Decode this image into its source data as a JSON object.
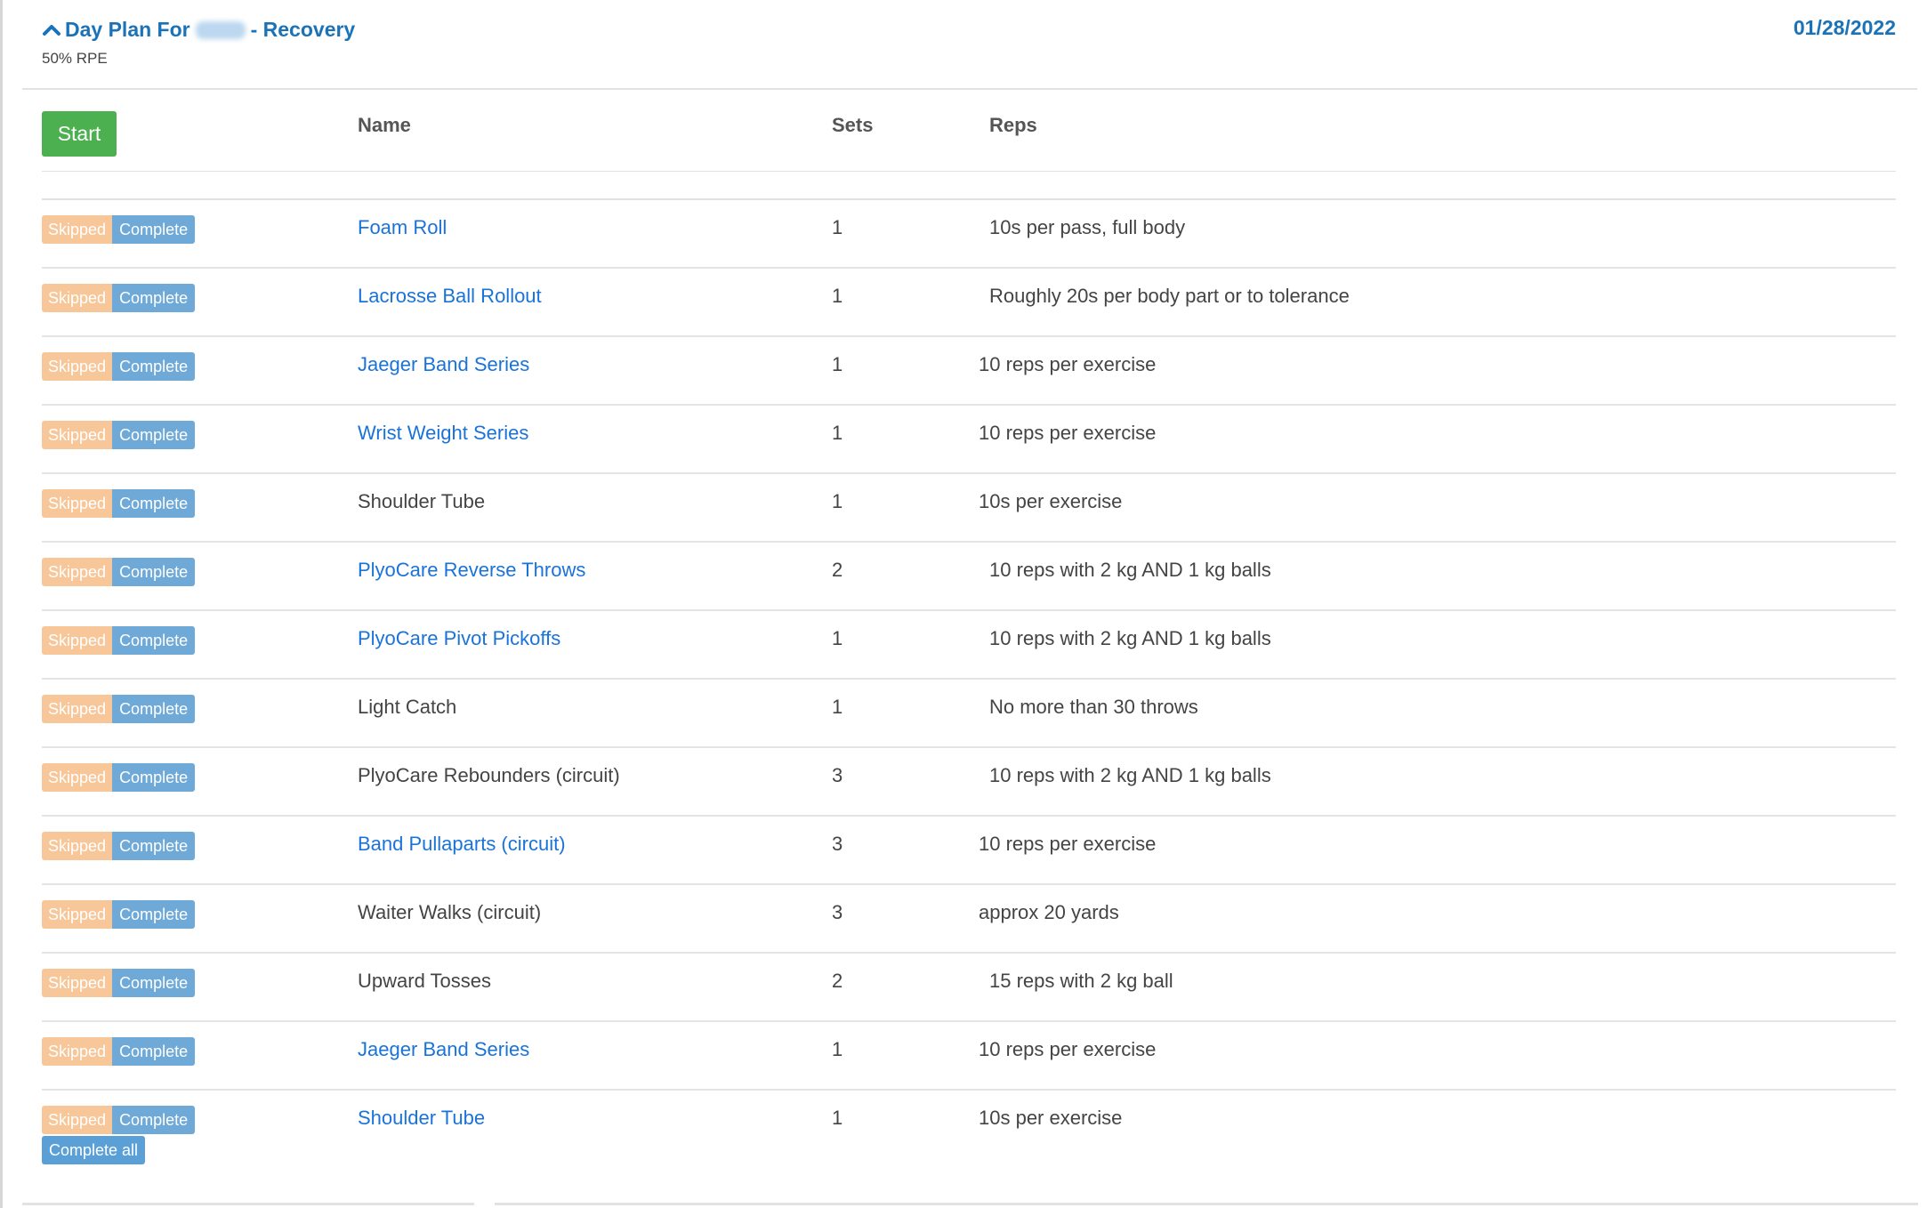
{
  "plan": {
    "title_prefix": "Day Plan For",
    "title_suffix": "- Recovery",
    "subtitle": "50% RPE",
    "date": "01/28/2022"
  },
  "table": {
    "start_label": "Start",
    "headers": {
      "name": "Name",
      "sets": "Sets",
      "reps": "Reps"
    },
    "skipped_label": "Skipped",
    "complete_label": "Complete",
    "complete_all_label": "Complete all",
    "rows": [
      {
        "name": "Foam Roll",
        "sets": "1",
        "reps": "10s per pass, full body"
      },
      {
        "name": "Lacrosse Ball Rollout",
        "sets": "1",
        "reps": "Roughly 20s per body part or to tolerance"
      },
      {
        "name": "Jaeger Band Series",
        "sets": "1",
        "reps": "10 reps per exercise"
      },
      {
        "name": "Wrist Weight Series",
        "sets": "1",
        "reps": "10 reps per exercise"
      },
      {
        "name": "Shoulder Tube",
        "sets": "1",
        "reps": "10s per exercise"
      },
      {
        "name": "PlyoCare Reverse Throws",
        "sets": "2",
        "reps": "10 reps with 2 kg AND 1 kg balls"
      },
      {
        "name": "PlyoCare Pivot Pickoffs",
        "sets": "1",
        "reps": "10 reps with 2 kg AND 1 kg balls"
      },
      {
        "name": "Light Catch",
        "sets": "1",
        "reps": "No more than 30 throws"
      },
      {
        "name": "PlyoCare Rebounders (circuit)",
        "sets": "3",
        "reps": "10 reps with 2 kg AND 1 kg balls"
      },
      {
        "name": "Band Pullaparts (circuit)",
        "sets": "3",
        "reps": "10 reps per exercise"
      },
      {
        "name": "Waiter Walks (circuit)",
        "sets": "3",
        "reps": "approx 20 yards"
      },
      {
        "name": "Upward Tosses",
        "sets": "2",
        "reps": "15 reps with 2 kg ball"
      },
      {
        "name": "Jaeger Band Series",
        "sets": "1",
        "reps": "10 reps per exercise"
      },
      {
        "name": "Shoulder Tube",
        "sets": "1",
        "reps": "10s per exercise"
      }
    ]
  },
  "colors": {
    "title_blue": "#1a73b8",
    "link_blue": "#1a73d8",
    "start_green": "#4caf50",
    "skipped_orange": "#f7c79a",
    "complete_blue": "#6ea9d8"
  },
  "icons": {
    "collapse": "chevron-up-icon"
  }
}
